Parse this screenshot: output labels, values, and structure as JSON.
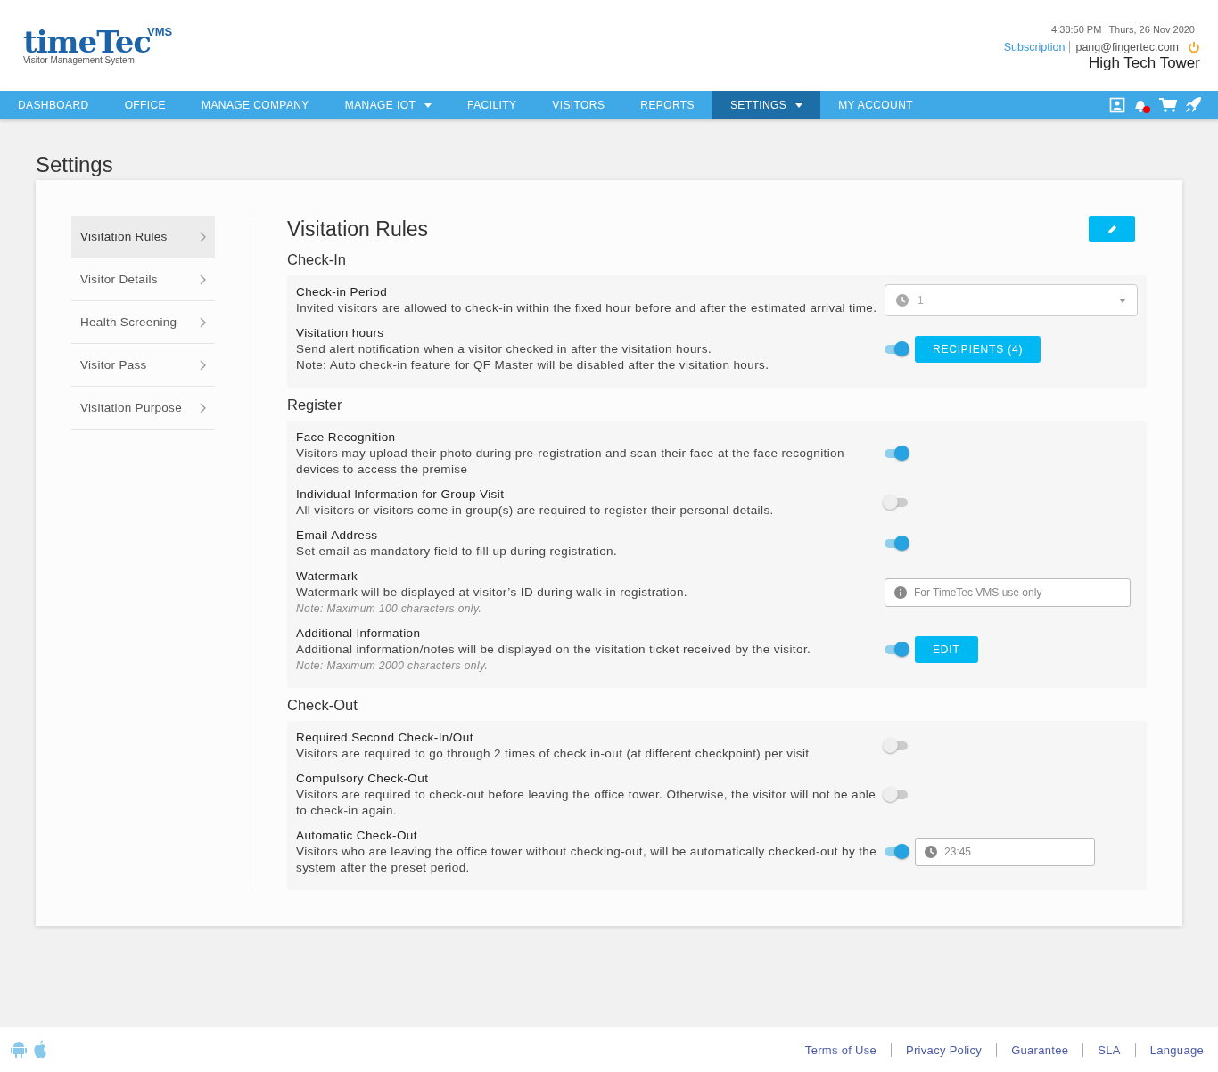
{
  "logo": {
    "wordmark": "timeTec",
    "badge": "VMS",
    "tagline": "Visitor Management System"
  },
  "header": {
    "time": "4:38:50 PM",
    "date": "Thurs, 26 Nov 2020",
    "subscription": "Subscription",
    "email": "pang@fingertec.com",
    "company": "High Tech Tower"
  },
  "nav": [
    {
      "label": "DASHBOARD",
      "selected": false,
      "dropdown": false
    },
    {
      "label": "OFFICE",
      "selected": false,
      "dropdown": false
    },
    {
      "label": "MANAGE COMPANY",
      "selected": false,
      "dropdown": false
    },
    {
      "label": "MANAGE IOT",
      "selected": false,
      "dropdown": true
    },
    {
      "label": "FACILITY",
      "selected": false,
      "dropdown": false
    },
    {
      "label": "VISITORS",
      "selected": false,
      "dropdown": false
    },
    {
      "label": "REPORTS",
      "selected": false,
      "dropdown": false
    },
    {
      "label": "SETTINGS",
      "selected": true,
      "dropdown": true
    },
    {
      "label": "MY ACCOUNT",
      "selected": false,
      "dropdown": false
    }
  ],
  "page_title": "Settings",
  "sidebar": [
    {
      "label": "Visitation Rules",
      "selected": true
    },
    {
      "label": "Visitor Details",
      "selected": false
    },
    {
      "label": "Health Screening",
      "selected": false
    },
    {
      "label": "Visitor Pass",
      "selected": false
    },
    {
      "label": "Visitation Purpose",
      "selected": false
    }
  ],
  "content_title": "Visitation Rules",
  "sections": [
    {
      "title": "Check-In",
      "rows": [
        {
          "title": "Check-in Period",
          "lines": [
            "Invited visitors are allowed to check-in within the fixed hour before and after the estimated arrival time."
          ],
          "controls": [
            {
              "kind": "select",
              "value": "1"
            }
          ]
        },
        {
          "title": "Visitation hours",
          "lines": [
            "Send alert notification when a visitor checked in after the visitation hours.",
            "Note: Auto check-in feature for QF Master will be disabled after the visitation hours."
          ],
          "controls": [
            {
              "kind": "toggle",
              "on": true
            },
            {
              "kind": "button",
              "label": "RECIPIENTS (4)"
            }
          ]
        }
      ]
    },
    {
      "title": "Register",
      "rows": [
        {
          "title": "Face Recognition",
          "lines": [
            "Visitors may upload their photo during pre-registration and scan their face at the face recognition devices to access the premise"
          ],
          "controls": [
            {
              "kind": "toggle",
              "on": true
            }
          ]
        },
        {
          "title": "Individual Information for Group Visit",
          "lines": [
            "All visitors or visitors come in group(s) are required to register their personal details."
          ],
          "controls": [
            {
              "kind": "toggle",
              "on": false
            }
          ]
        },
        {
          "title": "Email Address",
          "lines": [
            "Set email as mandatory field to fill up during registration."
          ],
          "controls": [
            {
              "kind": "toggle",
              "on": true
            }
          ]
        },
        {
          "title": "Watermark",
          "lines": [
            "Watermark will be displayed at visitor’s ID during walk-in registration."
          ],
          "note": "Note: Maximum 100 characters only.",
          "controls": [
            {
              "kind": "field",
              "placeholder": "For TimeTec VMS use only"
            }
          ]
        },
        {
          "title": "Additional Information",
          "lines": [
            "Additional information/notes will be displayed on the visitation ticket received by the visitor."
          ],
          "note": "Note: Maximum 2000 characters only.",
          "controls": [
            {
              "kind": "toggle",
              "on": true
            },
            {
              "kind": "button",
              "label": "EDIT"
            }
          ]
        }
      ]
    },
    {
      "title": "Check-Out",
      "rows": [
        {
          "title": "Required Second Check-In/Out",
          "lines": [
            "Visitors are required to go through 2 times of check in-out (at different checkpoint) per visit."
          ],
          "controls": [
            {
              "kind": "toggle",
              "on": false
            }
          ]
        },
        {
          "title": "Compulsory Check-Out",
          "lines": [
            "Visitors are required to check-out before leaving the office tower. Otherwise, the visitor will not be able to check-in again."
          ],
          "controls": [
            {
              "kind": "toggle",
              "on": false
            }
          ]
        },
        {
          "title": "Automatic Check-Out",
          "lines": [
            "Visitors who are leaving the office tower without checking-out, will be automatically checked-out by the system after the preset period."
          ],
          "controls": [
            {
              "kind": "toggle",
              "on": true
            },
            {
              "kind": "time",
              "value": "23:45"
            }
          ]
        }
      ]
    }
  ],
  "footer": [
    "Terms of Use",
    "Privacy Policy",
    "Guarantee",
    "SLA",
    "Language"
  ]
}
